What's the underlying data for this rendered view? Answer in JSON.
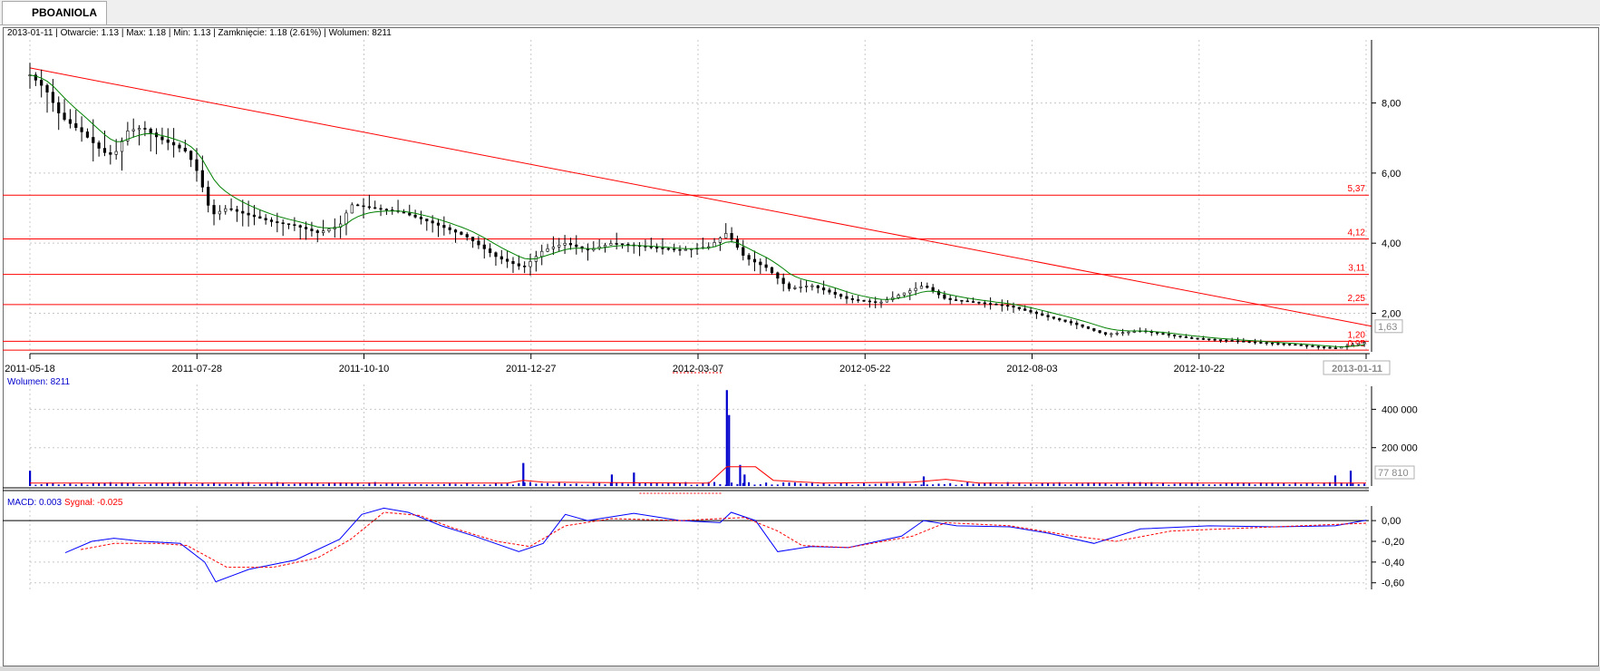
{
  "tab": {
    "label": "PBOANIOLA"
  },
  "info": {
    "price_line": "2013-01-11 | Otwarcie: 1.13 | Max: 1.18 | Min: 1.13 | Zamknięcie: 1.18 (2.61%)  | Wolumen: 8211",
    "volume_label": "Wolumen: 8211",
    "macd_label": "MACD: 0.003",
    "signal_label": "Sygnał: -0.025"
  },
  "colors": {
    "candle": "#000000",
    "moving_average": "#008000",
    "support_lines": "#ff0000",
    "trend_line": "#ff0000",
    "volume_bars": "#0000cc",
    "volume_average": "#ff0000",
    "macd": "#0000ff",
    "signal": "#ff0000",
    "grid": "#c8c8c8"
  },
  "chart_data": [
    {
      "type": "candlestick",
      "panel": "price",
      "x_ticks": [
        "2011-05-18",
        "2011-07-28",
        "2011-10-10",
        "2011-12-27",
        "2012-03-07",
        "2012-05-22",
        "2012-08-03",
        "2012-10-22",
        "2013-01-11"
      ],
      "y_ticks": [
        "8,00",
        "6,00",
        "4,00",
        "2,00"
      ],
      "ylim": [
        0.9,
        9.8
      ],
      "grid": true,
      "last_value_label": "1,63",
      "levels": [
        {
          "label": "5,37",
          "value": 5.37
        },
        {
          "label": "4,12",
          "value": 4.12
        },
        {
          "label": "3,11",
          "value": 3.11
        },
        {
          "label": "2,25",
          "value": 2.25
        },
        {
          "label": "1,20",
          "value": 1.2
        },
        {
          "label": "0,95",
          "value": 0.95
        }
      ],
      "trend_line": {
        "from": {
          "date": "2011-05-18",
          "value": 9.0
        },
        "to": {
          "date": "2013-01-11",
          "value": 1.63
        }
      },
      "close_path": [
        [
          "2011-05-18",
          8.8
        ],
        [
          "2011-05-25",
          8.4
        ],
        [
          "2011-06-01",
          7.6
        ],
        [
          "2011-06-10",
          7.2
        ],
        [
          "2011-06-20",
          6.6
        ],
        [
          "2011-06-25",
          6.5
        ],
        [
          "2011-07-01",
          7.2
        ],
        [
          "2011-07-08",
          7.3
        ],
        [
          "2011-07-15",
          7.0
        ],
        [
          "2011-07-22",
          6.8
        ],
        [
          "2011-07-28",
          6.6
        ],
        [
          "2011-08-02",
          6.0
        ],
        [
          "2011-08-08",
          4.8
        ],
        [
          "2011-08-15",
          5.0
        ],
        [
          "2011-08-25",
          4.8
        ],
        [
          "2011-09-05",
          4.6
        ],
        [
          "2011-09-15",
          4.5
        ],
        [
          "2011-09-25",
          4.3
        ],
        [
          "2011-10-05",
          4.5
        ],
        [
          "2011-10-10",
          5.1
        ],
        [
          "2011-10-20",
          5.0
        ],
        [
          "2011-11-01",
          4.9
        ],
        [
          "2011-11-15",
          4.6
        ],
        [
          "2011-12-01",
          4.2
        ],
        [
          "2011-12-15",
          3.6
        ],
        [
          "2011-12-27",
          3.3
        ],
        [
          "2012-01-05",
          3.8
        ],
        [
          "2012-01-15",
          4.0
        ],
        [
          "2012-01-25",
          3.8
        ],
        [
          "2012-02-05",
          4.0
        ],
        [
          "2012-02-20",
          3.9
        ],
        [
          "2012-03-07",
          3.8
        ],
        [
          "2012-03-20",
          3.9
        ],
        [
          "2012-03-28",
          4.3
        ],
        [
          "2012-04-05",
          3.6
        ],
        [
          "2012-04-15",
          3.3
        ],
        [
          "2012-04-25",
          2.7
        ],
        [
          "2012-05-05",
          2.8
        ],
        [
          "2012-05-22",
          2.4
        ],
        [
          "2012-06-05",
          2.3
        ],
        [
          "2012-06-25",
          2.8
        ],
        [
          "2012-07-05",
          2.4
        ],
        [
          "2012-07-20",
          2.3
        ],
        [
          "2012-08-03",
          2.2
        ],
        [
          "2012-08-20",
          1.9
        ],
        [
          "2012-09-01",
          1.7
        ],
        [
          "2012-09-15",
          1.4
        ],
        [
          "2012-10-01",
          1.5
        ],
        [
          "2012-10-22",
          1.3
        ],
        [
          "2012-11-15",
          1.2
        ],
        [
          "2012-12-10",
          1.1
        ],
        [
          "2012-12-28",
          1.0
        ],
        [
          "2013-01-11",
          1.18
        ]
      ]
    },
    {
      "type": "bar",
      "panel": "volume",
      "series_name": "Wolumen",
      "y_ticks": [
        "400 000",
        "200 000"
      ],
      "ylim": [
        0,
        520000
      ],
      "last_value_label": "77 810",
      "bars": [
        [
          "2011-05-18",
          80000
        ],
        [
          "2011-12-27",
          120000
        ],
        [
          "2012-02-05",
          60000
        ],
        [
          "2012-02-15",
          70000
        ],
        [
          "2012-03-28",
          500000
        ],
        [
          "2012-03-29",
          370000
        ],
        [
          "2012-04-03",
          110000
        ],
        [
          "2012-04-05",
          60000
        ],
        [
          "2012-06-25",
          50000
        ],
        [
          "2012-12-28",
          55000
        ],
        [
          "2013-01-04",
          80000
        ]
      ],
      "baseline_bar_value": 15000,
      "average_path": [
        [
          "2011-05-18",
          15000
        ],
        [
          "2011-12-20",
          15000
        ],
        [
          "2011-12-27",
          30000
        ],
        [
          "2012-01-05",
          20000
        ],
        [
          "2012-03-20",
          15000
        ],
        [
          "2012-03-28",
          100000
        ],
        [
          "2012-04-10",
          100000
        ],
        [
          "2012-04-18",
          30000
        ],
        [
          "2012-05-10",
          15000
        ],
        [
          "2012-06-20",
          20000
        ],
        [
          "2012-07-05",
          35000
        ],
        [
          "2012-07-20",
          15000
        ],
        [
          "2013-01-11",
          15000
        ]
      ]
    },
    {
      "type": "line",
      "panel": "macd",
      "y_ticks": [
        "0,00",
        "-0,20",
        "-0,40",
        "-0,60"
      ],
      "ylim": [
        -0.62,
        0.08
      ],
      "series": [
        {
          "name": "MACD",
          "points": [
            [
              "2011-06-03",
              -0.31
            ],
            [
              "2011-06-15",
              -0.2
            ],
            [
              "2011-06-25",
              -0.17
            ],
            [
              "2011-07-08",
              -0.2
            ],
            [
              "2011-07-25",
              -0.22
            ],
            [
              "2011-08-05",
              -0.4
            ],
            [
              "2011-08-10",
              -0.59
            ],
            [
              "2011-08-25",
              -0.47
            ],
            [
              "2011-09-15",
              -0.38
            ],
            [
              "2011-10-05",
              -0.18
            ],
            [
              "2011-10-15",
              0.06
            ],
            [
              "2011-10-25",
              0.12
            ],
            [
              "2011-11-05",
              0.08
            ],
            [
              "2011-11-20",
              -0.05
            ],
            [
              "2011-12-05",
              -0.15
            ],
            [
              "2011-12-25",
              -0.3
            ],
            [
              "2012-01-05",
              -0.22
            ],
            [
              "2012-01-15",
              0.06
            ],
            [
              "2012-01-25",
              0.0
            ],
            [
              "2012-02-15",
              0.07
            ],
            [
              "2012-03-07",
              0.0
            ],
            [
              "2012-03-25",
              -0.02
            ],
            [
              "2012-03-30",
              0.08
            ],
            [
              "2012-04-10",
              0.0
            ],
            [
              "2012-04-20",
              -0.3
            ],
            [
              "2012-05-05",
              -0.25
            ],
            [
              "2012-05-22",
              -0.26
            ],
            [
              "2012-06-15",
              -0.15
            ],
            [
              "2012-06-25",
              0.0
            ],
            [
              "2012-07-10",
              -0.05
            ],
            [
              "2012-08-03",
              -0.06
            ],
            [
              "2012-08-20",
              -0.12
            ],
            [
              "2012-09-10",
              -0.22
            ],
            [
              "2012-10-01",
              -0.08
            ],
            [
              "2012-11-01",
              -0.05
            ],
            [
              "2012-12-01",
              -0.06
            ],
            [
              "2012-12-28",
              -0.05
            ],
            [
              "2013-01-11",
              0.003
            ]
          ]
        },
        {
          "name": "Sygnał",
          "points": [
            [
              "2011-06-10",
              -0.28
            ],
            [
              "2011-06-25",
              -0.22
            ],
            [
              "2011-07-15",
              -0.22
            ],
            [
              "2011-07-28",
              -0.24
            ],
            [
              "2011-08-15",
              -0.45
            ],
            [
              "2011-09-05",
              -0.45
            ],
            [
              "2011-09-25",
              -0.36
            ],
            [
              "2011-10-10",
              -0.18
            ],
            [
              "2011-10-25",
              0.08
            ],
            [
              "2011-11-10",
              0.05
            ],
            [
              "2011-11-25",
              -0.07
            ],
            [
              "2011-12-15",
              -0.2
            ],
            [
              "2011-12-30",
              -0.25
            ],
            [
              "2012-01-15",
              -0.05
            ],
            [
              "2012-02-05",
              0.02
            ],
            [
              "2012-03-07",
              0.0
            ],
            [
              "2012-04-05",
              0.03
            ],
            [
              "2012-04-20",
              -0.1
            ],
            [
              "2012-05-01",
              -0.24
            ],
            [
              "2012-05-22",
              -0.26
            ],
            [
              "2012-06-20",
              -0.15
            ],
            [
              "2012-07-05",
              -0.02
            ],
            [
              "2012-08-03",
              -0.05
            ],
            [
              "2012-09-01",
              -0.15
            ],
            [
              "2012-09-20",
              -0.2
            ],
            [
              "2012-10-15",
              -0.1
            ],
            [
              "2012-12-01",
              -0.06
            ],
            [
              "2013-01-11",
              -0.025
            ]
          ]
        }
      ]
    }
  ]
}
